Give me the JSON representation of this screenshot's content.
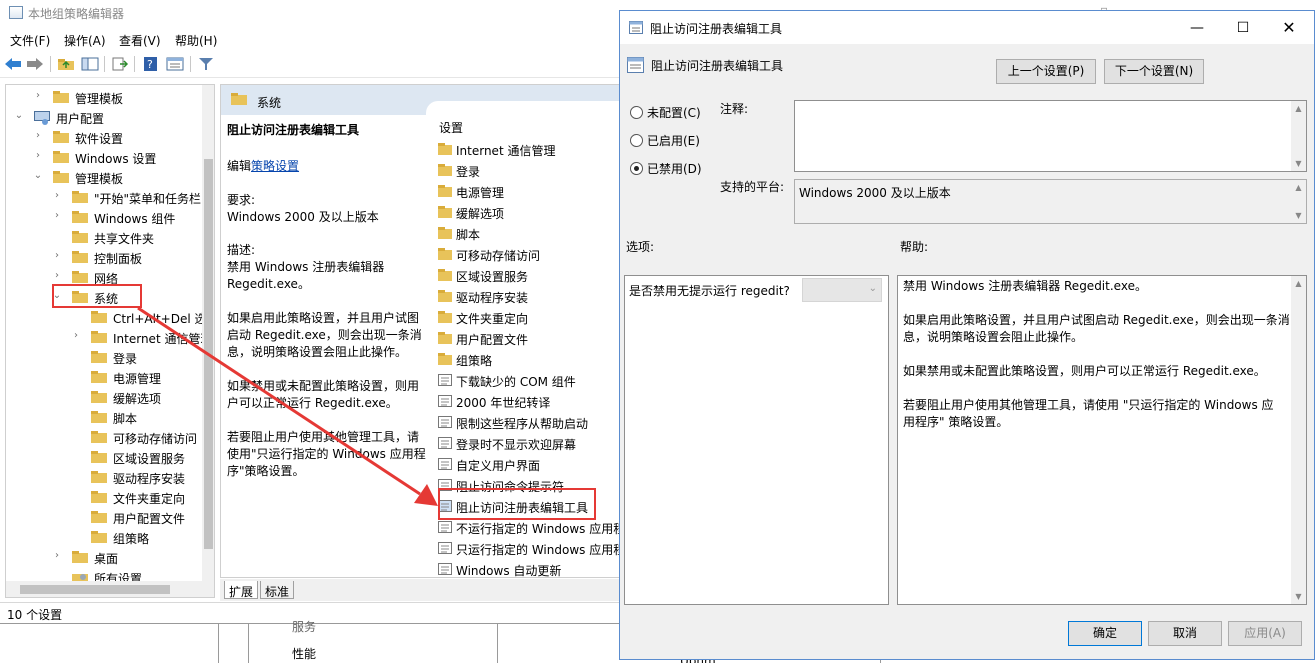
{
  "editor": {
    "title": "本地组策略编辑器",
    "menu": [
      "文件(F)",
      "操作(A)",
      "查看(V)",
      "帮助(H)"
    ],
    "tree": [
      {
        "label": "管理模板",
        "depth": 1,
        "exp": "›"
      },
      {
        "label": "用户配置",
        "depth": 0,
        "exp": "⌄",
        "icon": "computer"
      },
      {
        "label": "软件设置",
        "depth": 1,
        "exp": "›"
      },
      {
        "label": "Windows 设置",
        "depth": 1,
        "exp": "›"
      },
      {
        "label": "管理模板",
        "depth": 1,
        "exp": "⌄"
      },
      {
        "label": "\"开始\"菜单和任务栏",
        "depth": 2,
        "exp": "›"
      },
      {
        "label": "Windows 组件",
        "depth": 2,
        "exp": "›"
      },
      {
        "label": "共享文件夹",
        "depth": 2,
        "exp": ""
      },
      {
        "label": "控制面板",
        "depth": 2,
        "exp": "›"
      },
      {
        "label": "网络",
        "depth": 2,
        "exp": "›"
      },
      {
        "label": "系统",
        "depth": 2,
        "exp": "⌄"
      },
      {
        "label": "Ctrl+Alt+Del 选项",
        "depth": 3,
        "exp": ""
      },
      {
        "label": "Internet 通信管理",
        "depth": 3,
        "exp": "›"
      },
      {
        "label": "登录",
        "depth": 3,
        "exp": ""
      },
      {
        "label": "电源管理",
        "depth": 3,
        "exp": ""
      },
      {
        "label": "缓解选项",
        "depth": 3,
        "exp": ""
      },
      {
        "label": "脚本",
        "depth": 3,
        "exp": ""
      },
      {
        "label": "可移动存储访问",
        "depth": 3,
        "exp": ""
      },
      {
        "label": "区域设置服务",
        "depth": 3,
        "exp": ""
      },
      {
        "label": "驱动程序安装",
        "depth": 3,
        "exp": ""
      },
      {
        "label": "文件夹重定向",
        "depth": 3,
        "exp": ""
      },
      {
        "label": "用户配置文件",
        "depth": 3,
        "exp": ""
      },
      {
        "label": "组策略",
        "depth": 3,
        "exp": ""
      },
      {
        "label": "桌面",
        "depth": 2,
        "exp": "›"
      },
      {
        "label": "所有设置",
        "depth": 2,
        "exp": "",
        "icon": "settings"
      }
    ],
    "detail_header": "系统",
    "desc": {
      "title": "阻止访问注册表编辑工具",
      "edit_prefix": "编辑",
      "edit_link": "策略设置",
      "req_label": "要求:",
      "req_value": "Windows 2000 及以上版本",
      "desc_label": "描述:",
      "lines": [
        "禁用 Windows 注册表编辑器",
        "Regedit.exe。",
        "",
        "如果启用此策略设置，并且用户试图",
        "启动 Regedit.exe，则会出现一条消",
        "息，说明策略设置会阻止此操作。",
        "",
        "如果禁用或未配置此策略设置，则用",
        "户可以正常运行 Regedit.exe。",
        "",
        "若要阻止用户使用其他管理工具，请",
        "使用\"只运行指定的 Windows 应用程",
        "序\"策略设置。"
      ]
    },
    "settings_head": "设置",
    "settings": [
      {
        "label": "Internet 通信管理",
        "kind": "folder"
      },
      {
        "label": "登录",
        "kind": "folder"
      },
      {
        "label": "电源管理",
        "kind": "folder"
      },
      {
        "label": "缓解选项",
        "kind": "folder"
      },
      {
        "label": "脚本",
        "kind": "folder"
      },
      {
        "label": "可移动存储访问",
        "kind": "folder"
      },
      {
        "label": "区域设置服务",
        "kind": "folder"
      },
      {
        "label": "驱动程序安装",
        "kind": "folder"
      },
      {
        "label": "文件夹重定向",
        "kind": "folder"
      },
      {
        "label": "用户配置文件",
        "kind": "folder"
      },
      {
        "label": "组策略",
        "kind": "folder"
      },
      {
        "label": "下载缺少的 COM 组件",
        "kind": "policy"
      },
      {
        "label": "2000 年世纪转译",
        "kind": "policy"
      },
      {
        "label": "限制这些程序从帮助启动",
        "kind": "policy"
      },
      {
        "label": "登录时不显示欢迎屏幕",
        "kind": "policy"
      },
      {
        "label": "自定义用户界面",
        "kind": "policy"
      },
      {
        "label": "阻止访问命令提示符",
        "kind": "policy"
      },
      {
        "label": "阻止访问注册表编辑工具",
        "kind": "policy-selected"
      },
      {
        "label": "不运行指定的 Windows 应用程序",
        "kind": "policy"
      },
      {
        "label": "只运行指定的 Windows 应用程序",
        "kind": "policy"
      },
      {
        "label": "Windows 自动更新",
        "kind": "policy"
      }
    ],
    "tabs": [
      "扩展",
      "标准"
    ],
    "status": "10 个设置",
    "bottom_labels": [
      "服务",
      "性能",
      "Ubhm"
    ]
  },
  "dialog": {
    "title": "阻止访问注册表编辑工具",
    "header_title": "阻止访问注册表编辑工具",
    "prev_btn": "上一个设置(P)",
    "next_btn": "下一个设置(N)",
    "radios": [
      {
        "label": "未配置(C)",
        "checked": false
      },
      {
        "label": "已启用(E)",
        "checked": false
      },
      {
        "label": "已禁用(D)",
        "checked": true
      }
    ],
    "comment_label": "注释:",
    "comment_value": "",
    "platform_label": "支持的平台:",
    "platform_value": "Windows 2000 及以上版本",
    "options_label": "选项:",
    "help_label": "帮助:",
    "option_question": "是否禁用无提示运行 regedit?",
    "option_select_value": "",
    "help_lines": [
      "禁用 Windows 注册表编辑器 Regedit.exe。",
      "",
      "如果启用此策略设置，并且用户试图启动 Regedit.exe，则会出现一条消",
      "息，说明策略设置会阻止此操作。",
      "",
      "如果禁用或未配置此策略设置，则用户可以正常运行 Regedit.exe。",
      "",
      "若要阻止用户使用其他管理工具，请使用 \"只运行指定的 Windows 应",
      "用程序\" 策略设置。"
    ],
    "ok": "确定",
    "cancel": "取消",
    "apply": "应用(A)"
  },
  "colors": {
    "folder": "#e8c35a",
    "annotation": "#e53935",
    "accent": "#0078d7",
    "link": "#0645ad"
  }
}
